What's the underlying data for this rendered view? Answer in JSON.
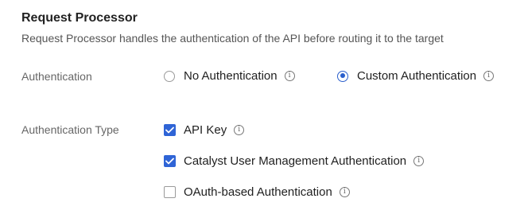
{
  "section": {
    "title": "Request Processor",
    "subtitle": "Request Processor handles the authentication of the API before routing it to the target"
  },
  "authentication": {
    "label": "Authentication",
    "options": [
      {
        "label": "No Authentication",
        "selected": false,
        "info_icon": "info-icon"
      },
      {
        "label": "Custom Authentication",
        "selected": true,
        "info_icon": "info-icon"
      }
    ]
  },
  "authentication_type": {
    "label": "Authentication Type",
    "options": [
      {
        "label": "API Key",
        "checked": true,
        "info_icon": "info-icon"
      },
      {
        "label": "Catalyst User Management Authentication",
        "checked": true,
        "info_icon": "info-icon"
      },
      {
        "label": "OAuth-based Authentication",
        "checked": false,
        "info_icon": "info-icon"
      }
    ]
  },
  "colors": {
    "accent": "#2f64d6",
    "label_text": "#666666",
    "body_text": "#1f1f1f"
  },
  "icons": {
    "info": "i",
    "check": "check-icon"
  }
}
